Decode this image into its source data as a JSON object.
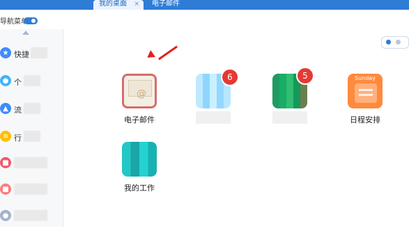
{
  "tabs": [
    {
      "label": "我的桌面",
      "close": "×"
    },
    {
      "label": "电子邮件"
    }
  ],
  "nav": {
    "title": "导航菜单",
    "items": [
      {
        "label": "快捷",
        "icon": "quick-icon",
        "color": "#3d8bff"
      },
      {
        "label": "个",
        "icon": "user-icon",
        "color": "#42b3ff"
      },
      {
        "label": "流",
        "icon": "workflow-icon",
        "color": "#3d8bff"
      },
      {
        "label": "行",
        "icon": "admin-icon",
        "color": "#ffbf00"
      },
      {
        "label": "",
        "icon": "app-icon",
        "color": "#f05a6b"
      },
      {
        "label": "",
        "icon": "calendar-icon",
        "color": "#ff7b7b"
      },
      {
        "label": "",
        "icon": "more-icon",
        "color": "#a2b3c9"
      }
    ]
  },
  "desktop": {
    "apps": [
      {
        "label": "电子邮件",
        "icon": "email-app-icon",
        "badge": ""
      },
      {
        "label": "",
        "icon": "unknown-app-1-icon",
        "badge": "6"
      },
      {
        "label": "",
        "icon": "unknown-app-2-icon",
        "badge": "5"
      },
      {
        "label": "日程安排",
        "icon": "schedule-app-icon",
        "badge": "",
        "icon_text": "Sunday"
      },
      {
        "label": "我的工作",
        "icon": "folder-app-icon",
        "badge": ""
      }
    ]
  }
}
